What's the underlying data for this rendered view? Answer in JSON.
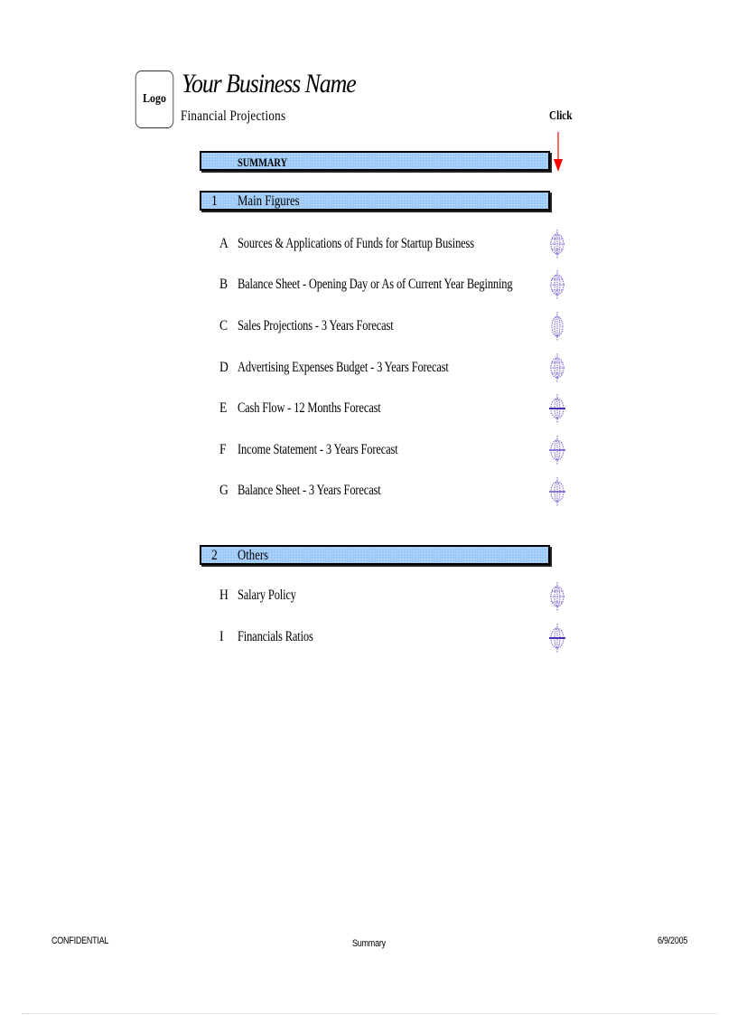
{
  "header": {
    "logo_label": "Logo",
    "business_name": "Your Business Name",
    "subtitle": "Financial  Projections",
    "click_label": "Click",
    "arrow_color": "#ff0000"
  },
  "summary_bar": {
    "label": "SUMMARY"
  },
  "sections": [
    {
      "number": "1",
      "title": "Main Figures",
      "items": [
        {
          "letter": "A",
          "label": "Sources & Applications of Funds for  Startup  Business",
          "icon": "globe-link-icon"
        },
        {
          "letter": "B",
          "label": "Balance Sheet - Opening Day or As of Current Year Beginning",
          "icon": "globe-link-icon"
        },
        {
          "letter": "C",
          "label": "Sales Projections - 3 Years Forecast",
          "icon": "globe-link-icon"
        },
        {
          "letter": "D",
          "label": "Advertising Expenses Budget - 3 Years Forecast",
          "icon": "globe-link-icon"
        },
        {
          "letter": "E",
          "label": "Cash Flow - 12 Months Forecast",
          "icon": "globe-link-icon"
        },
        {
          "letter": "F",
          "label": "Income Statement - 3 Years Forecast",
          "icon": "globe-link-icon"
        },
        {
          "letter": "G",
          "label": "Balance Sheet - 3 Years Forecast",
          "icon": "globe-link-icon"
        }
      ]
    },
    {
      "number": "2",
      "title": "Others",
      "items": [
        {
          "letter": "H",
          "label": "Salary Policy",
          "icon": "globe-link-icon"
        },
        {
          "letter": "I",
          "label": "Financials Ratios",
          "icon": "globe-link-icon"
        }
      ]
    }
  ],
  "colors": {
    "bar_fill": "#9fcaf8",
    "icon_color": "#7a5fd0"
  },
  "footer": {
    "left": "CONFIDENTIAL",
    "center": "Summary",
    "right": "6/9/2005"
  }
}
